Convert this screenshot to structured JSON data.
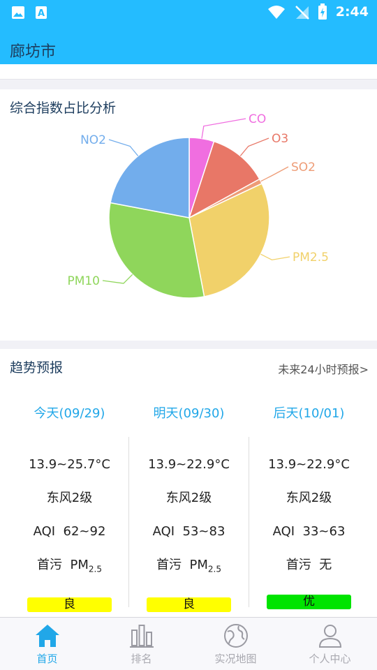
{
  "status_bar": {
    "time": "2:44"
  },
  "app_bar": {
    "title": "廊坊市"
  },
  "pie_card": {
    "title": "综合指数占比分析",
    "chart_data": {
      "type": "pie",
      "categories": [
        "CO",
        "O3",
        "SO2",
        "PM2.5",
        "PM10",
        "NO2"
      ],
      "values": [
        5,
        12,
        1,
        29,
        31,
        22
      ],
      "colors": [
        "#f06ee0",
        "#e87767",
        "#ee9c76",
        "#f1d16a",
        "#8fd65b",
        "#72adec"
      ]
    }
  },
  "trend": {
    "title": "趋势预报",
    "link": "未来24小时预报>",
    "days": [
      {
        "label": "今天(09/29)",
        "temp": "13.9~25.7°C",
        "wind": "东风2级",
        "aqi_label": "AQI",
        "aqi": "62~92",
        "pollutant_label": "首污",
        "pollutant": "PM",
        "pollutant_sub": "2.5",
        "level": "良",
        "level_color": "#ffff00"
      },
      {
        "label": "明天(09/30)",
        "temp": "13.9~22.9°C",
        "wind": "东风2级",
        "aqi_label": "AQI",
        "aqi": "53~83",
        "pollutant_label": "首污",
        "pollutant": "PM",
        "pollutant_sub": "2.5",
        "level": "良",
        "level_color": "#ffff00"
      },
      {
        "label": "后天(10/01)",
        "temp": "13.9~22.9°C",
        "wind": "东风2级",
        "aqi_label": "AQI",
        "aqi": "33~63",
        "pollutant_label": "首污",
        "pollutant": "无",
        "pollutant_sub": "",
        "level": "优",
        "level_color": "#00e400"
      }
    ]
  },
  "tabs": [
    {
      "label": "首页",
      "icon": "home-icon",
      "active": true
    },
    {
      "label": "排名",
      "icon": "bar-chart-icon",
      "active": false
    },
    {
      "label": "实况地图",
      "icon": "globe-icon",
      "active": false
    },
    {
      "label": "个人中心",
      "icon": "person-icon",
      "active": false
    }
  ]
}
